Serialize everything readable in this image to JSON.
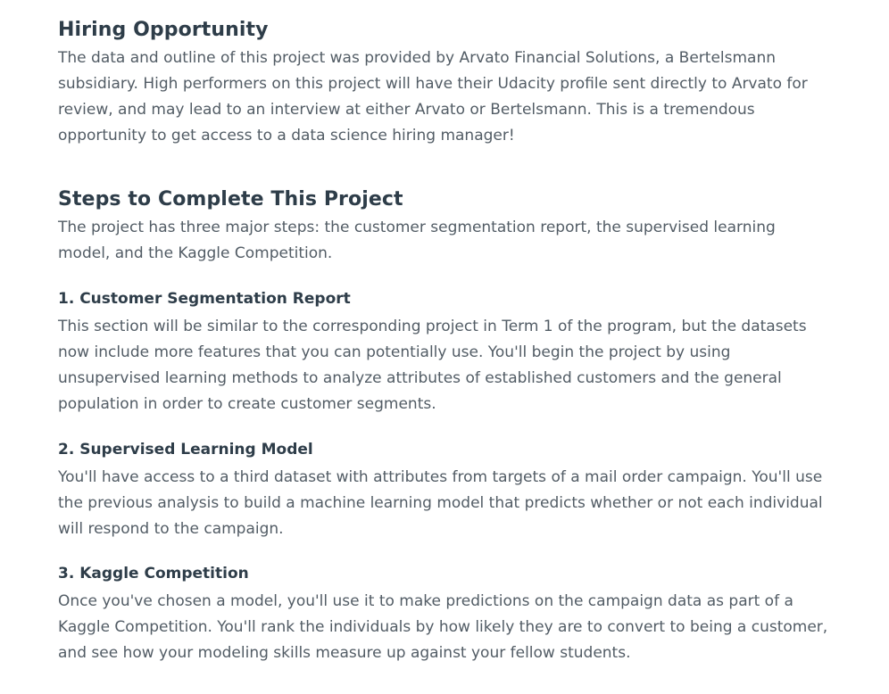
{
  "hiring": {
    "title": "Hiring Opportunity",
    "body": "The data and outline of this project was provided by Arvato Financial Solutions, a Bertelsmann subsidiary. High performers on this project will have their Udacity profile sent directly to Arvato for review, and may lead to an interview at either Arvato or Bertelsmann. This is a tremendous opportunity to get access to a data science hiring manager!"
  },
  "steps": {
    "title": "Steps to Complete This Project",
    "intro": "The project has three major steps: the customer segmentation report, the supervised learning model, and the Kaggle Competition.",
    "items": [
      {
        "heading": "1. Customer Segmentation Report",
        "body": "This section will be similar to the corresponding project in Term 1 of the program, but the datasets now include more features that you can potentially use. You'll begin the project by using unsupervised learning methods to analyze attributes of established customers and the general population in order to create customer segments."
      },
      {
        "heading": "2. Supervised Learning Model",
        "body": "You'll have access to a third dataset with attributes from targets of a mail order campaign. You'll use the previous analysis to build a machine learning model that predicts whether or not each individual will respond to the campaign."
      },
      {
        "heading": "3. Kaggle Competition",
        "body": "Once you've chosen a model, you'll use it to make predictions on the campaign data as part of a Kaggle Competition. You'll rank the individuals by how likely they are to convert to being a customer, and see how your modeling skills measure up against your fellow students."
      }
    ]
  }
}
